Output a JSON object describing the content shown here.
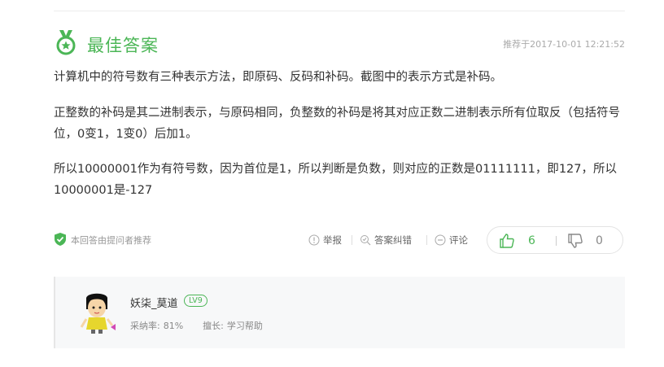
{
  "header": {
    "title": "最佳答案",
    "recommend_time": "推荐于2017-10-01 12:21:52"
  },
  "answer": {
    "paragraphs": [
      "计算机中的符号数有三种表示方法，即原码、反码和补码。截图中的表示方式是补码。",
      "正整数的补码是其二进制表示，与原码相同，负整数的补码是将其对应正数二进制表示所有位取反（包括符号位，0变1，1变0）后加1。",
      "所以10000001作为有符号数，因为首位是1，所以判断是负数，则对应的正数是01111111，即127，所以10000001是-127"
    ]
  },
  "footer": {
    "by_asker": "本回答由提问者推荐",
    "report": "举报",
    "correction": "答案纠错",
    "comment": "评论",
    "upvotes": "6",
    "downvotes": "0"
  },
  "user": {
    "name": "妖柒_莫道",
    "level": "LV9",
    "adoption_label": "采纳率:",
    "adoption_rate": "81%",
    "expertise_label": "擅长:",
    "expertise": "学习帮助"
  },
  "colors": {
    "accent": "#4bb656",
    "text": "#333333",
    "muted": "#999999"
  }
}
